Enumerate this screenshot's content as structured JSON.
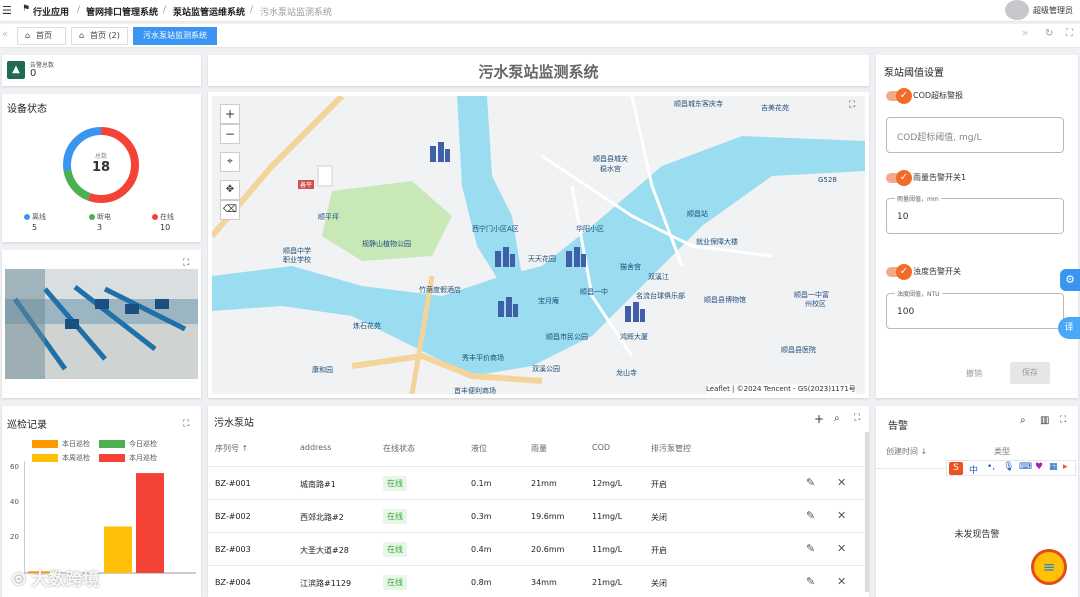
{
  "header": {
    "menu_icon": "hamburger-icon",
    "crumbs": [
      "行业应用",
      "管网排口管理系统",
      "泵站监管运维系统",
      "污水泵站监测系统"
    ],
    "user": "超级管理员"
  },
  "tabs": [
    {
      "label": "首页"
    },
    {
      "label": "首页 (2)"
    },
    {
      "label": "污水泵站监测系统"
    }
  ],
  "alarm_total": {
    "label": "告警总数",
    "value": "0"
  },
  "device_status": {
    "title": "设备状态",
    "center_label": "总数",
    "center_value": "18",
    "legend": [
      {
        "label": "离线",
        "value": "5",
        "color": "#3a95f2"
      },
      {
        "label": "断电",
        "value": "3",
        "color": "#4caf50"
      },
      {
        "label": "在线",
        "value": "10",
        "color": "#f44336"
      }
    ]
  },
  "main_title": "污水泵站监测系统",
  "map": {
    "attribution": "Leaflet | ©2024 Tencent - GS(2023)1171号",
    "zoom_in": "+",
    "zoom_out": "−",
    "labels": [
      "顺昌城东客庆寺",
      "吉美花苑",
      "顺昌县城关",
      "稳水宫",
      "顺昌站",
      "规静山植物公园",
      "西宁门小区A区",
      "华阳小区",
      "顺昌中学",
      "职业学校",
      "就业保障大楼",
      "天天花园",
      "猫舍宫",
      "竹荫度假酒店",
      "宝月庵",
      "顺昌一中",
      "名流台球俱乐部",
      "顺昌县博物馆",
      "顺昌一中富",
      "州校区",
      "炼石花苑",
      "顺昌市民公园",
      "鸿辉大厦",
      "顺昌县医院",
      "康和园",
      "秀丰平价商场",
      "双溪公园",
      "龙山寺",
      "首丰便利商场",
      "G528",
      "善平",
      "顺平坪",
      "双溪江"
    ]
  },
  "threshold": {
    "title": "泵站阈值设置",
    "cod_toggle": "COD超标警报",
    "cod_placeholder": "COD超标阈值, mg/L",
    "rain_toggle": "雨量告警开关1",
    "rain_label": "雨量阈值，mm",
    "rain_value": "10",
    "turb_toggle": "浊度告警开关",
    "turb_label": "浊度阈值，NTU",
    "turb_value": "100",
    "cancel": "撤销",
    "save": "保存"
  },
  "patrol": {
    "title": "巡检记录",
    "legend": [
      {
        "label": "本日巡检",
        "color": "#ff9800"
      },
      {
        "label": "今日巡检",
        "color": "#4caf50"
      },
      {
        "label": "本周巡检",
        "color": "#ffc107"
      },
      {
        "label": "本月巡检",
        "color": "#f44336"
      }
    ],
    "yticks": [
      "60",
      "40",
      "20"
    ]
  },
  "chart_data": {
    "type": "bar",
    "series": [
      {
        "name": "本日巡检",
        "values": [
          1
        ]
      },
      {
        "name": "今日巡检",
        "values": [
          0
        ]
      },
      {
        "name": "本周巡检",
        "values": [
          27
        ]
      },
      {
        "name": "本月巡检",
        "values": [
          58
        ]
      }
    ],
    "ylim": [
      0,
      65
    ]
  },
  "pump_table": {
    "title": "污水泵站",
    "columns": [
      "序列号",
      "address",
      "在线状态",
      "液位",
      "雨量",
      "COD",
      "排污泵管控"
    ],
    "rows": [
      [
        "BZ-#001",
        "城南路#1",
        "在线",
        "0.1m",
        "21mm",
        "12mg/L",
        "开启"
      ],
      [
        "BZ-#002",
        "西郊北路#2",
        "在线",
        "0.3m",
        "19.6mm",
        "11mg/L",
        "关闭"
      ],
      [
        "BZ-#003",
        "大圣大道#28",
        "在线",
        "0.4m",
        "20.6mm",
        "11mg/L",
        "开启"
      ],
      [
        "BZ-#004",
        "江滨路#1129",
        "在线",
        "0.8m",
        "34mm",
        "21mg/L",
        "关闭"
      ]
    ]
  },
  "alarm_panel": {
    "title": "告警",
    "col1": "创建时间",
    "col2": "类型",
    "empty": "未发现告警"
  },
  "ime": {
    "s_icon": "S",
    "zh": "中"
  },
  "watermark": "大数跨境",
  "side_tab": "译"
}
